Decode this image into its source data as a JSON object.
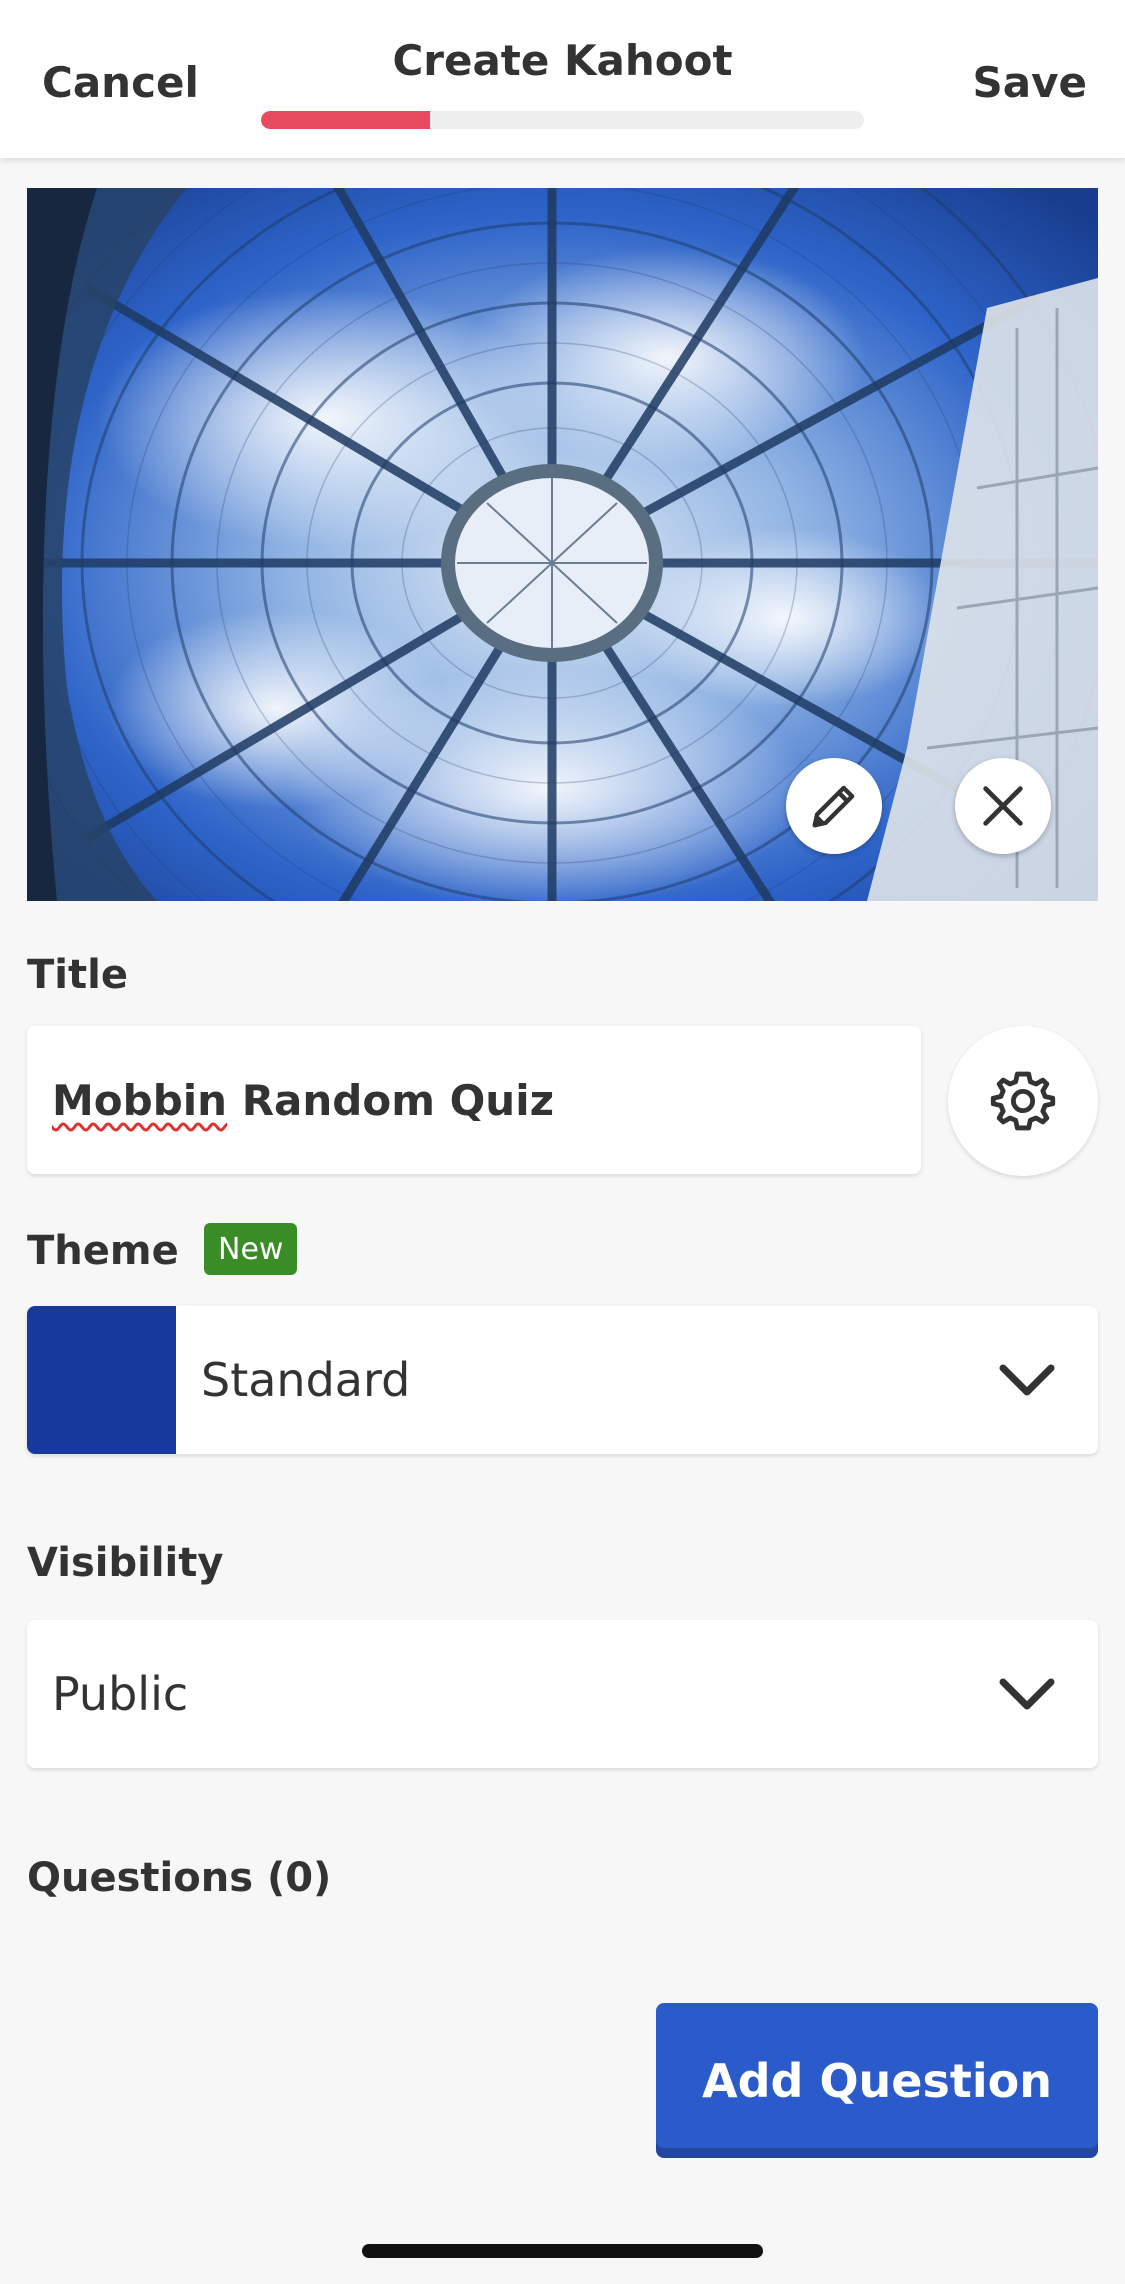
{
  "header": {
    "cancel_label": "Cancel",
    "title": "Create Kahoot",
    "save_label": "Save",
    "progress_fraction": 0.28,
    "progress_color": "#e84a5f"
  },
  "cover": {
    "edit_icon": "pencil-icon",
    "remove_icon": "close-icon"
  },
  "title_field": {
    "label": "Title",
    "value_misspelled": "Mobbin",
    "value_rest": " Random Quiz",
    "settings_icon": "gear-icon"
  },
  "theme": {
    "label": "Theme",
    "badge": "New",
    "badge_color": "#3a8c27",
    "selected": "Standard",
    "swatch_color": "#17399c"
  },
  "visibility": {
    "label": "Visibility",
    "selected": "Public"
  },
  "questions": {
    "label": "Questions (0)",
    "add_button_label": "Add Question",
    "add_button_color": "#2b5bcb"
  }
}
